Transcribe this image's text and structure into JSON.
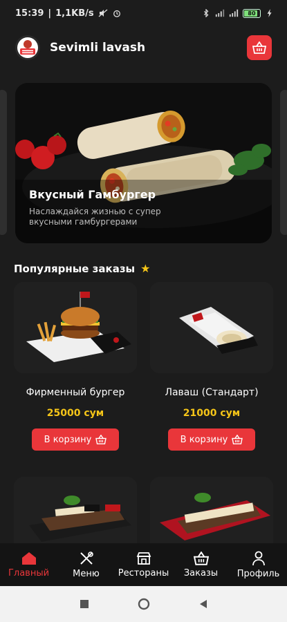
{
  "status_bar": {
    "time": "15:39",
    "speed": "1,1KB/s",
    "battery": "80"
  },
  "header": {
    "title": "Sevimli lavash",
    "logo_text": "SEVIMLI LAVASH"
  },
  "banner": {
    "title": "Вкусный Гамбургер",
    "subtitle": "Наслаждайся жизнью с супер вкусными гамбургерами"
  },
  "popular": {
    "title": "Популярные заказы",
    "items": [
      {
        "name": "Фирменный бургер",
        "price": "25000 сум",
        "button": "В корзину"
      },
      {
        "name": "Лаваш (Стандарт)",
        "price": "21000 сум",
        "button": "В корзину"
      }
    ]
  },
  "bottom_nav": {
    "items": [
      {
        "label": "Главный",
        "icon": "home-icon",
        "active": true
      },
      {
        "label": "Меню",
        "icon": "cutlery-icon",
        "active": false
      },
      {
        "label": "Рестораны",
        "icon": "store-icon",
        "active": false
      },
      {
        "label": "Заказы",
        "icon": "basket-icon",
        "active": false
      },
      {
        "label": "Профиль",
        "icon": "user-icon",
        "active": false
      }
    ]
  },
  "colors": {
    "accent": "#e9363a",
    "price": "#f5c518",
    "background": "#1c1c1c"
  }
}
